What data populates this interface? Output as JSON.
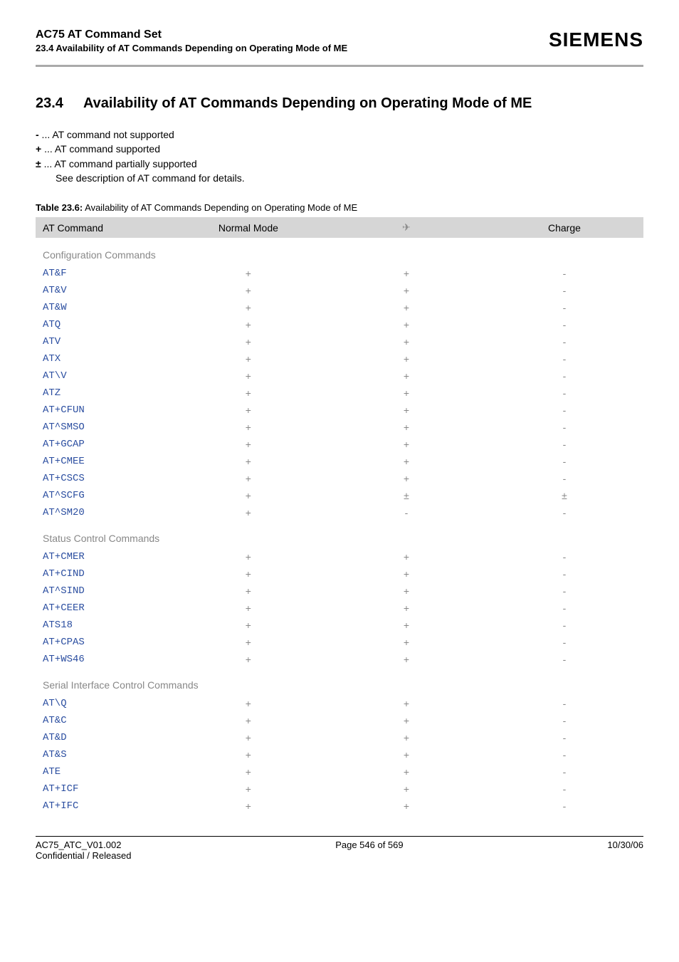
{
  "header": {
    "title": "AC75 AT Command Set",
    "subtitle": "23.4 Availability of AT Commands Depending on Operating Mode of ME",
    "brand": "SIEMENS"
  },
  "section": {
    "number": "23.4",
    "title": "Availability of AT Commands Depending on Operating Mode of ME"
  },
  "legend": {
    "l1sym": "-",
    "l1txt": " ... AT command not supported",
    "l2sym": "+",
    "l2txt": " ... AT command supported",
    "l3sym": "±",
    "l3txt": " ... AT command partially supported",
    "l4txt": "See description of AT command for details."
  },
  "table": {
    "caption_label": "Table 23.6:",
    "caption_text": "  Availability of AT Commands Depending on Operating Mode of ME",
    "headers": {
      "c1": "AT Command",
      "c2": "Normal Mode",
      "c3": "✈",
      "c4": "Charge"
    },
    "sections": [
      {
        "title": "Configuration Commands",
        "rows": [
          {
            "cmd": "AT&F",
            "c2": "+",
            "c3": "+",
            "c4": "-"
          },
          {
            "cmd": "AT&V",
            "c2": "+",
            "c3": "+",
            "c4": "-"
          },
          {
            "cmd": "AT&W",
            "c2": "+",
            "c3": "+",
            "c4": "-"
          },
          {
            "cmd": "ATQ",
            "c2": "+",
            "c3": "+",
            "c4": "-"
          },
          {
            "cmd": "ATV",
            "c2": "+",
            "c3": "+",
            "c4": "-"
          },
          {
            "cmd": "ATX",
            "c2": "+",
            "c3": "+",
            "c4": "-"
          },
          {
            "cmd": "AT\\V",
            "c2": "+",
            "c3": "+",
            "c4": "-"
          },
          {
            "cmd": "ATZ",
            "c2": "+",
            "c3": "+",
            "c4": "-"
          },
          {
            "cmd": "AT+CFUN",
            "c2": "+",
            "c3": "+",
            "c4": "-"
          },
          {
            "cmd": "AT^SMSO",
            "c2": "+",
            "c3": "+",
            "c4": "-"
          },
          {
            "cmd": "AT+GCAP",
            "c2": "+",
            "c3": "+",
            "c4": "-"
          },
          {
            "cmd": "AT+CMEE",
            "c2": "+",
            "c3": "+",
            "c4": "-"
          },
          {
            "cmd": "AT+CSCS",
            "c2": "+",
            "c3": "+",
            "c4": "-"
          },
          {
            "cmd": "AT^SCFG",
            "c2": "+",
            "c3": "±",
            "c4": "±"
          },
          {
            "cmd": "AT^SM20",
            "c2": "+",
            "c3": "-",
            "c4": "-"
          }
        ]
      },
      {
        "title": "Status Control Commands",
        "rows": [
          {
            "cmd": "AT+CMER",
            "c2": "+",
            "c3": "+",
            "c4": "-"
          },
          {
            "cmd": "AT+CIND",
            "c2": "+",
            "c3": "+",
            "c4": "-"
          },
          {
            "cmd": "AT^SIND",
            "c2": "+",
            "c3": "+",
            "c4": "-"
          },
          {
            "cmd": "AT+CEER",
            "c2": "+",
            "c3": "+",
            "c4": "-"
          },
          {
            "cmd": "ATS18",
            "c2": "+",
            "c3": "+",
            "c4": "-"
          },
          {
            "cmd": "AT+CPAS",
            "c2": "+",
            "c3": "+",
            "c4": "-"
          },
          {
            "cmd": "AT+WS46",
            "c2": "+",
            "c3": "+",
            "c4": "-"
          }
        ]
      },
      {
        "title": "Serial Interface Control Commands",
        "rows": [
          {
            "cmd": "AT\\Q",
            "c2": "+",
            "c3": "+",
            "c4": "-"
          },
          {
            "cmd": "AT&C",
            "c2": "+",
            "c3": "+",
            "c4": "-"
          },
          {
            "cmd": "AT&D",
            "c2": "+",
            "c3": "+",
            "c4": "-"
          },
          {
            "cmd": "AT&S",
            "c2": "+",
            "c3": "+",
            "c4": "-"
          },
          {
            "cmd": "ATE",
            "c2": "+",
            "c3": "+",
            "c4": "-"
          },
          {
            "cmd": "AT+ICF",
            "c2": "+",
            "c3": "+",
            "c4": "-"
          },
          {
            "cmd": "AT+IFC",
            "c2": "+",
            "c3": "+",
            "c4": "-"
          }
        ]
      }
    ]
  },
  "footer": {
    "left1": "AC75_ATC_V01.002",
    "left2": "Confidential / Released",
    "center": "Page 546 of 569",
    "right": "10/30/06"
  }
}
